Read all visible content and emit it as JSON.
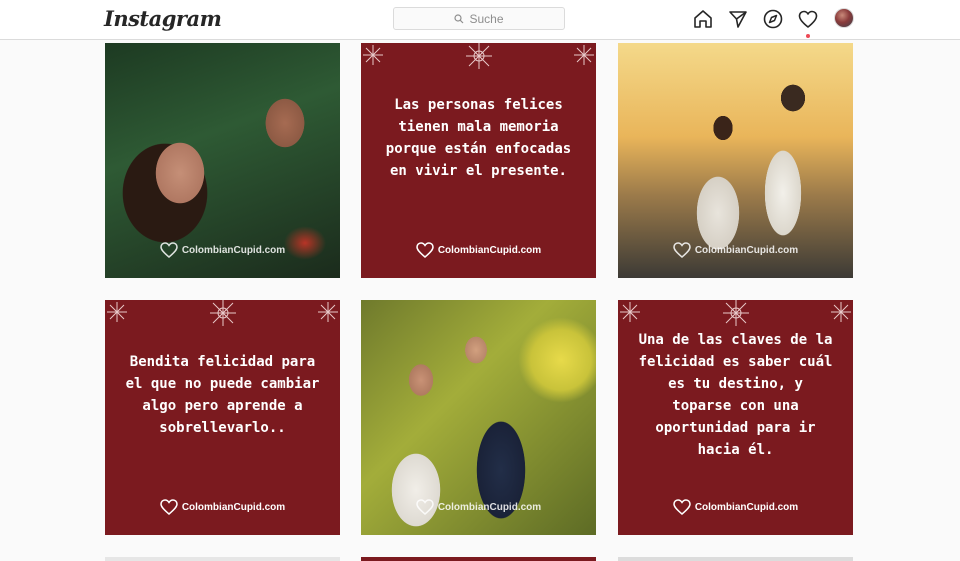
{
  "header": {
    "logo_text": "Instagram",
    "search": {
      "placeholder": "Suche"
    },
    "nav_icons": [
      "home-icon",
      "direct-icon",
      "explore-icon",
      "activity-icon"
    ],
    "activity_notification": true
  },
  "grid": {
    "posts": [
      {
        "kind": "photo",
        "brand": "ColombianCupid.com"
      },
      {
        "kind": "quote",
        "text": "Las personas felices tienen mala memoria porque están enfocadas en vivir el presente.",
        "brand": "ColombianCupid.com"
      },
      {
        "kind": "photo",
        "brand": "ColombianCupid.com"
      },
      {
        "kind": "quote",
        "text": "Bendita felicidad para el que no puede cambiar algo pero aprende a sobrellevarlo..",
        "brand": "ColombianCupid.com"
      },
      {
        "kind": "photo",
        "brand": "ColombianCupid.com"
      },
      {
        "kind": "quote",
        "text": "Una de las claves de la felicidad es saber cuál es tu destino, y toparse con una oportunidad para ir hacia él.",
        "brand": "ColombianCupid.com"
      }
    ]
  },
  "colors": {
    "quote_background": "#7b1a1f",
    "notification_dot": "#ed4956",
    "border": "#dbdbdb"
  }
}
